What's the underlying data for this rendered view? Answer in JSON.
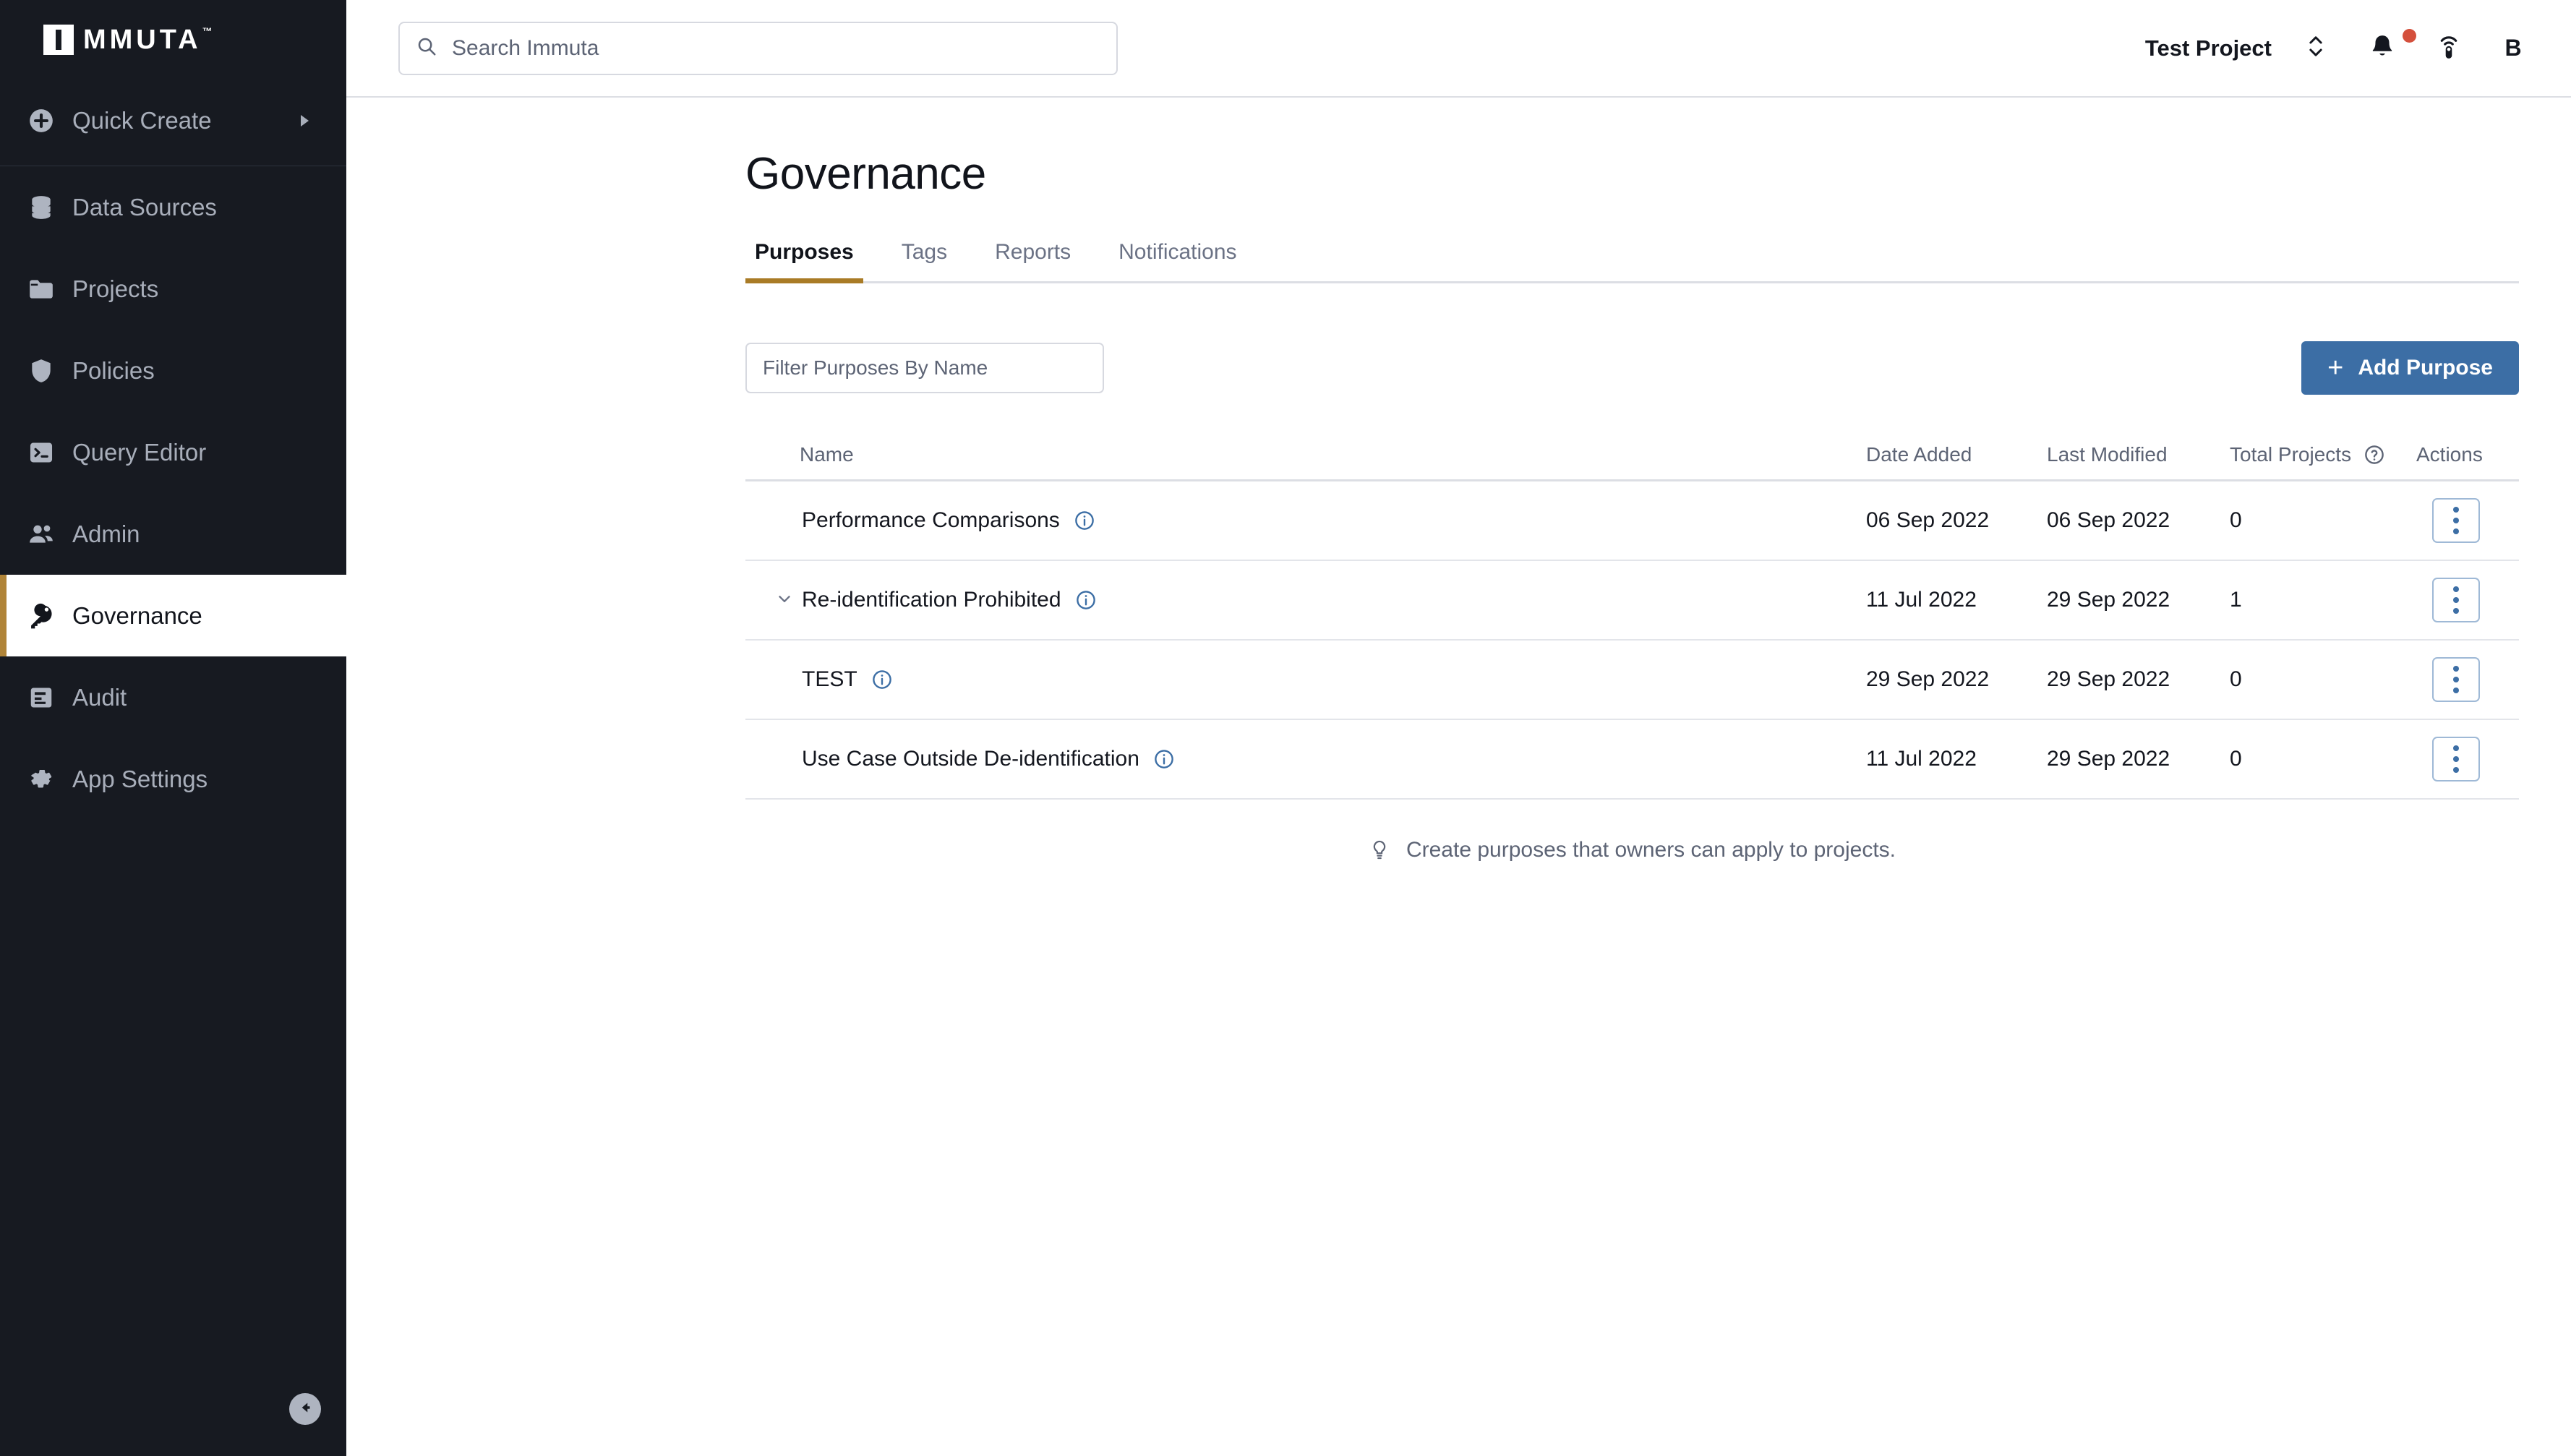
{
  "brand": {
    "logo_text": "MMUTA",
    "logo_tm": "™",
    "accent_gold": "#a97b26",
    "accent_blue": "#3c6ea5",
    "sidebar_bg": "#171a21"
  },
  "sidebar": {
    "items": [
      {
        "label": "Quick Create",
        "icon": "plus-circle-icon",
        "has_submenu": true,
        "active": false
      },
      {
        "label": "Data Sources",
        "icon": "database-icon",
        "has_submenu": false,
        "active": false
      },
      {
        "label": "Projects",
        "icon": "folder-icon",
        "has_submenu": false,
        "active": false
      },
      {
        "label": "Policies",
        "icon": "shield-icon",
        "has_submenu": false,
        "active": false
      },
      {
        "label": "Query Editor",
        "icon": "terminal-icon",
        "has_submenu": false,
        "active": false
      },
      {
        "label": "Admin",
        "icon": "people-icon",
        "has_submenu": false,
        "active": false
      },
      {
        "label": "Governance",
        "icon": "key-icon",
        "has_submenu": false,
        "active": true
      },
      {
        "label": "Audit",
        "icon": "list-box-icon",
        "has_submenu": false,
        "active": false
      },
      {
        "label": "App Settings",
        "icon": "gear-icon",
        "has_submenu": false,
        "active": false
      }
    ],
    "collapse_icon": "arrow-left-circle-icon"
  },
  "topbar": {
    "search": {
      "placeholder": "Search Immuta",
      "value": "",
      "icon": "search-icon"
    },
    "project_selector": {
      "label": "Test Project",
      "icon": "chevron-up-down-icon"
    },
    "notifications": {
      "icon": "bell-icon",
      "has_unread": true,
      "dot_color": "#d4503c"
    },
    "broadcast": {
      "icon": "broadcast-icon"
    },
    "avatar": {
      "initial": "B"
    }
  },
  "page": {
    "title": "Governance",
    "tabs": [
      {
        "label": "Purposes",
        "active": true
      },
      {
        "label": "Tags",
        "active": false
      },
      {
        "label": "Reports",
        "active": false
      },
      {
        "label": "Notifications",
        "active": false
      }
    ]
  },
  "toolbar": {
    "filter": {
      "placeholder": "Filter Purposes By Name",
      "value": ""
    },
    "add_button": {
      "label": "Add Purpose",
      "icon": "plus-icon"
    }
  },
  "table": {
    "columns": {
      "name": "Name",
      "date_added": "Date Added",
      "last_modified": "Last Modified",
      "total_projects": "Total Projects",
      "actions": "Actions"
    },
    "total_projects_help_icon": "question-circle-icon",
    "rows": [
      {
        "name": "Performance Comparisons",
        "expandable": false,
        "info_icon": "info-circle-icon",
        "date_added": "06 Sep 2022",
        "last_modified": "06 Sep 2022",
        "total_projects": "0",
        "actions_icon": "kebab-menu-icon"
      },
      {
        "name": "Re-identification Prohibited",
        "expandable": true,
        "expander_icon": "chevron-down-icon",
        "info_icon": "info-circle-icon",
        "date_added": "11 Jul 2022",
        "last_modified": "29 Sep 2022",
        "total_projects": "1",
        "actions_icon": "kebab-menu-icon"
      },
      {
        "name": "TEST",
        "expandable": false,
        "info_icon": "info-circle-icon",
        "date_added": "29 Sep 2022",
        "last_modified": "29 Sep 2022",
        "total_projects": "0",
        "actions_icon": "kebab-menu-icon"
      },
      {
        "name": "Use Case Outside De-identification",
        "expandable": false,
        "info_icon": "info-circle-icon",
        "date_added": "11 Jul 2022",
        "last_modified": "29 Sep 2022",
        "total_projects": "0",
        "actions_icon": "kebab-menu-icon"
      }
    ]
  },
  "footer_tip": {
    "icon": "lightbulb-icon",
    "text": "Create purposes that owners can apply to projects."
  }
}
